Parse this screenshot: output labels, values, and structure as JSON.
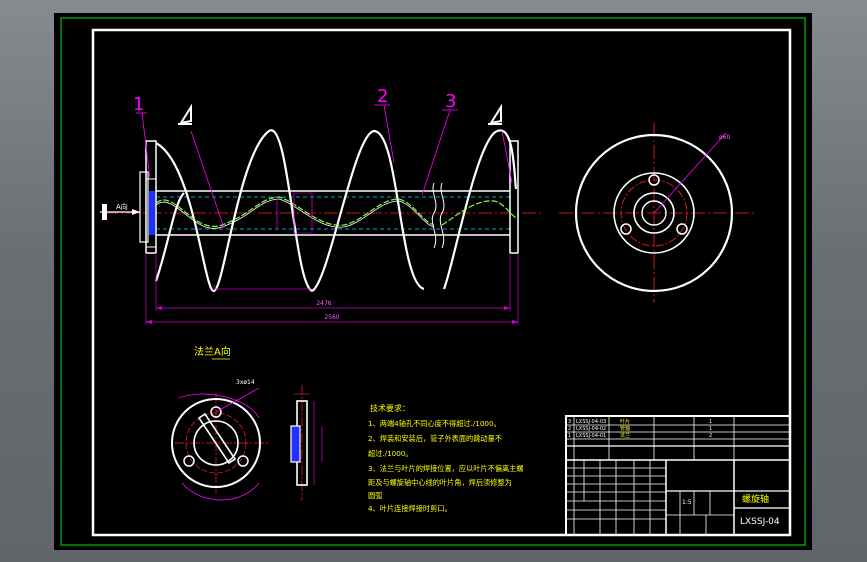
{
  "colors": {
    "background": "#000000",
    "outer_frame": "#00c000",
    "line": "#ffffff",
    "centerline": "#ff2020",
    "leader": "#ff00ff",
    "dimension": "#cc00cc",
    "hidden": "#00d0ff",
    "helix_fill": "#80ff40",
    "flange": "#2030ff",
    "text_yellow": "#ffff00",
    "weld": "#ffffff"
  },
  "icons": [
    "roughness-symbol",
    "pointer-arrow"
  ],
  "main_view": {
    "callouts": [
      "1",
      "2",
      "3"
    ],
    "arrow_label": "A向",
    "dimensions": {
      "inner_length": "2476",
      "overall_length": "2560",
      "diameter_note": "ø60"
    }
  },
  "side_view": {
    "label": "ø60"
  },
  "flange_detail": {
    "title": "法兰A向",
    "hole_label": "3xø14"
  },
  "tech_requirements": {
    "title": "技术要求：",
    "lines": [
      "1、两端4轴孔不同心度不得超过.∕1000。",
      "2、焊装和安装后，管子外表面的跳动量不",
      "超过.∕1000。",
      "3、法兰与叶片的焊接位置，应以叶片不偏离主螺",
      "距及与螺旋轴中心线的叶片角，焊后须修整为",
      "圆弧",
      "4、叶片连接焊接时剪口。"
    ]
  },
  "title_block": {
    "parts": [
      {
        "no": "3",
        "code": "LXSSJ-04-03",
        "name": "叶片",
        "qty": "1"
      },
      {
        "no": "2",
        "code": "LXSSJ-04-02",
        "name": "管轴",
        "qty": "1"
      },
      {
        "no": "1",
        "code": "LXSSJ-04-01",
        "name": "法兰",
        "qty": "2"
      }
    ],
    "drawing_name": "螺旋轴",
    "drawing_code": "LXSSJ-04",
    "scale": "1:5"
  }
}
